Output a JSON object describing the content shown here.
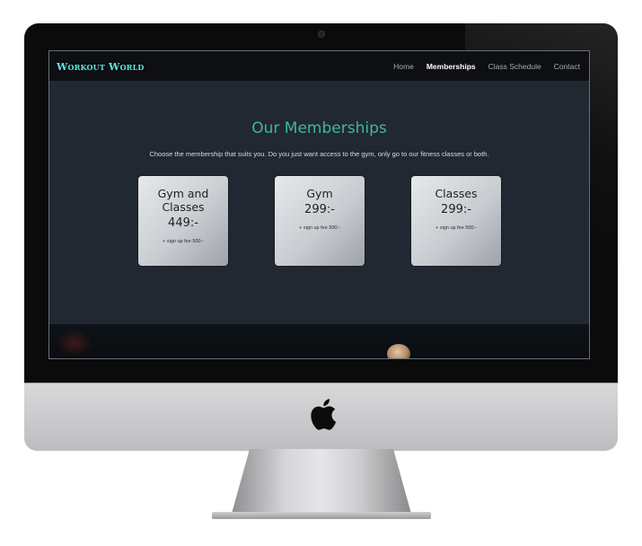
{
  "nav": {
    "logo": "Workout World",
    "items": [
      {
        "label": "Home",
        "active": false
      },
      {
        "label": "Memberships",
        "active": true
      },
      {
        "label": "Class Schedule",
        "active": false
      },
      {
        "label": "Contact",
        "active": false
      }
    ]
  },
  "page": {
    "title": "Our Memberships",
    "lead": "Choose the membership that suits you. Do you just want access to the gym, only go to our fitness classes or both."
  },
  "cards": [
    {
      "name_line1": "Gym and",
      "name_line2": "Classes",
      "price": "449:-",
      "fee": "+ sign up fee 500:-"
    },
    {
      "name_line1": "Gym",
      "name_line2": "",
      "price": "299:-",
      "fee": "+ sign up fee 500:-"
    },
    {
      "name_line1": "Classes",
      "name_line2": "",
      "price": "299:-",
      "fee": "+ sign up fee 500:-"
    }
  ],
  "colors": {
    "accent": "#3fb5a8",
    "logo": "#5fe6de",
    "background": "#222831",
    "nav_bg": "#0d0f12"
  },
  "icons": {
    "device_logo": "apple-icon"
  }
}
